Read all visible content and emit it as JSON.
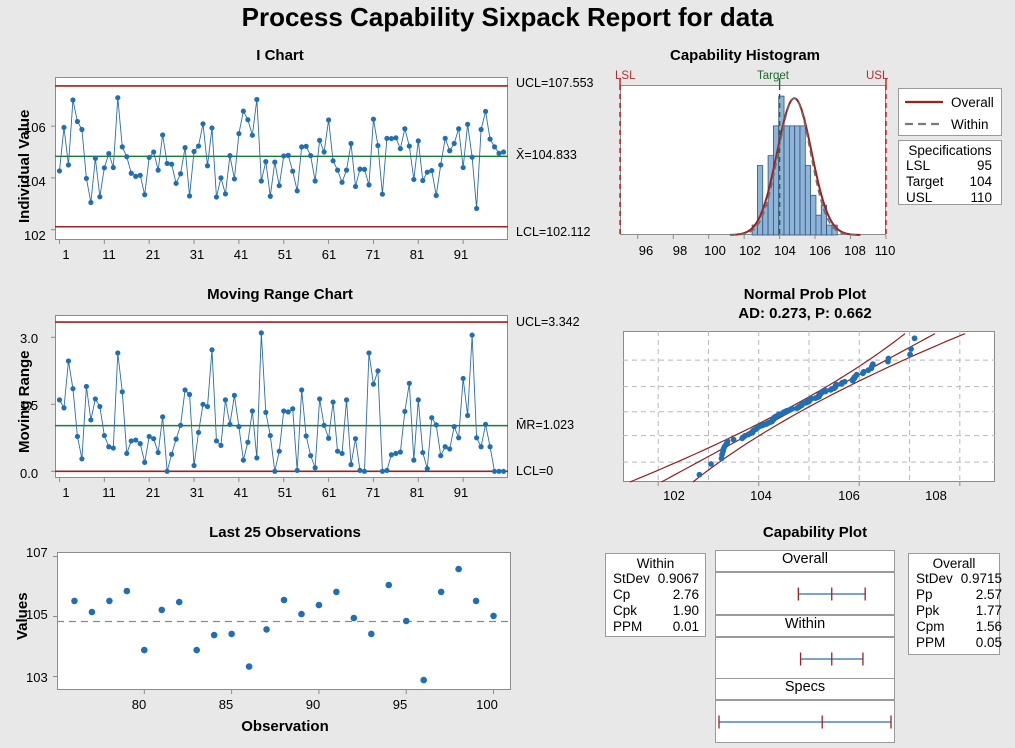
{
  "report": {
    "title": "Process Capability Sixpack Report for data"
  },
  "ichart": {
    "title": "I Chart",
    "ylabel": "Individual Value",
    "yticks": [
      "106",
      "104",
      "102"
    ],
    "xticks": [
      "1",
      "11",
      "21",
      "31",
      "41",
      "51",
      "61",
      "71",
      "81",
      "91"
    ],
    "ucl_label": "UCL=107.553",
    "center_label": "X̄=104.833",
    "lcl_label": "LCL=102.112"
  },
  "mrchart": {
    "title": "Moving Range Chart",
    "ylabel": "Moving Range",
    "yticks": [
      "3.0",
      "1.5",
      "0.0"
    ],
    "xticks": [
      "1",
      "11",
      "21",
      "31",
      "41",
      "51",
      "61",
      "71",
      "81",
      "91"
    ],
    "ucl_label": "UCL=3.342",
    "center_label": "M̄R=1.023",
    "lcl_label": "LCL=0"
  },
  "last25": {
    "title": "Last 25 Observations",
    "ylabel": "Values",
    "xlabel": "Observation",
    "yticks": [
      "107",
      "105",
      "103"
    ],
    "xticks": [
      "80",
      "85",
      "90",
      "95",
      "100"
    ]
  },
  "histogram": {
    "title": "Capability Histogram",
    "lsl_marker": "LSL",
    "target_marker": "Target",
    "usl_marker": "USL",
    "xticks": [
      "96",
      "98",
      "100",
      "102",
      "104",
      "106",
      "108",
      "110"
    ],
    "legend": [
      {
        "label": "Overall",
        "style": "solid",
        "color": "#9e2121"
      },
      {
        "label": "Within",
        "style": "dashed",
        "color": "#7a7a7a"
      }
    ],
    "spec_box": {
      "header": "Specifications",
      "rows": [
        {
          "key": "LSL",
          "value": "95"
        },
        {
          "key": "Target",
          "value": "104"
        },
        {
          "key": "USL",
          "value": "110"
        }
      ]
    }
  },
  "probplot": {
    "title": "Normal Prob Plot",
    "subtitle": "AD: 0.273, P: 0.662",
    "xticks": [
      "102",
      "104",
      "106",
      "108"
    ]
  },
  "capplot": {
    "title": "Capability Plot",
    "within_box": {
      "header": "Within",
      "rows": [
        {
          "key": "StDev",
          "value": "0.9067"
        },
        {
          "key": "Cp",
          "value": "2.76"
        },
        {
          "key": "Cpk",
          "value": "1.90"
        },
        {
          "key": "PPM",
          "value": "0.01"
        }
      ]
    },
    "overall_box": {
      "header": "Overall",
      "rows": [
        {
          "key": "StDev",
          "value": "0.9715"
        },
        {
          "key": "Pp",
          "value": "2.57"
        },
        {
          "key": "Ppk",
          "value": "1.77"
        },
        {
          "key": "Cpm",
          "value": "1.56"
        },
        {
          "key": "PPM",
          "value": "0.05"
        }
      ]
    },
    "bands": [
      {
        "label": "Overall"
      },
      {
        "label": "Within"
      },
      {
        "label": "Specs"
      }
    ]
  },
  "colors": {
    "background": "#e8e8e8",
    "plot_bg": "#ffffff",
    "control_limit": "#9e2121",
    "center_line": "#1a7a36",
    "marker": "#1f6fb4",
    "connect_line": "#2c6ea5",
    "bar_fill": "#8fb4d9",
    "bar_edge": "#33557a",
    "overall_curve": "#9e2121",
    "within_curve": "#6e6e6e",
    "target_line": "#1a6b2a",
    "spec_line": "#c01b1b",
    "grid": "#b8b8b8",
    "frame": "#8c8c8c"
  },
  "chart_data": {
    "type": "line",
    "title": "Process Capability Sixpack Report for data",
    "charts": [
      {
        "name": "I Chart",
        "type": "line",
        "ylabel": "Individual Value",
        "xlabel": "",
        "ylim": [
          101.6,
          107.9
        ],
        "xlim": [
          0,
          101
        ],
        "ucl": 107.553,
        "center": 104.833,
        "lcl": 102.112,
        "x": [
          1,
          2,
          3,
          4,
          5,
          6,
          7,
          8,
          9,
          10,
          11,
          12,
          13,
          14,
          15,
          16,
          17,
          18,
          19,
          20,
          21,
          22,
          23,
          24,
          25,
          26,
          27,
          28,
          29,
          30,
          31,
          32,
          33,
          34,
          35,
          36,
          37,
          38,
          39,
          40,
          41,
          42,
          43,
          44,
          45,
          46,
          47,
          48,
          49,
          50,
          51,
          52,
          53,
          54,
          55,
          56,
          57,
          58,
          59,
          60,
          61,
          62,
          63,
          64,
          65,
          66,
          67,
          68,
          69,
          70,
          71,
          72,
          73,
          74,
          75,
          76,
          77,
          78,
          79,
          80,
          81,
          82,
          83,
          84,
          85,
          86,
          87,
          88,
          89,
          90,
          91,
          92,
          93,
          94,
          95,
          96,
          97,
          98,
          99,
          100
        ],
        "values": [
          104.27,
          105.95,
          104.5,
          107.01,
          106.18,
          105.87,
          103.98,
          103.05,
          104.76,
          103.27,
          104.39,
          104.94,
          104.4,
          107.1,
          105.2,
          104.82,
          104.18,
          104.06,
          104.1,
          103.35,
          104.79,
          105.0,
          104.3,
          105.66,
          104.56,
          104.53,
          103.79,
          104.16,
          105.17,
          103.3,
          105.02,
          105.23,
          106.09,
          104.47,
          105.93,
          103.26,
          104.0,
          103.38,
          104.86,
          103.96,
          105.71,
          106.58,
          106.25,
          105.65,
          107.03,
          103.88,
          104.63,
          103.29,
          104.61,
          103.7,
          104.85,
          104.87,
          104.26,
          103.5,
          105.2,
          105.22,
          104.86,
          103.88,
          105.45,
          105.0,
          106.24,
          104.66,
          104.3,
          103.83,
          104.3,
          105.33,
          103.67,
          104.34,
          104.33,
          103.73,
          106.27,
          105.25,
          103.37,
          105.53,
          105.52,
          105.55,
          105.13,
          105.9,
          105.23,
          103.94,
          105.43,
          103.9,
          104.22,
          104.28,
          103.32,
          104.5,
          105.53,
          105.05,
          105.33,
          105.9,
          104.4,
          106.07,
          104.8,
          102.82,
          105.87,
          106.57,
          105.5,
          105.2,
          104.95,
          105.0
        ]
      },
      {
        "name": "Moving Range Chart",
        "type": "line",
        "ylabel": "Moving Range",
        "xlabel": "",
        "ylim": [
          -0.15,
          3.5
        ],
        "xlim": [
          0,
          101
        ],
        "ucl": 3.342,
        "center": 1.023,
        "lcl": 0,
        "x": [
          1,
          2,
          3,
          4,
          5,
          6,
          7,
          8,
          9,
          10,
          11,
          12,
          13,
          14,
          15,
          16,
          17,
          18,
          19,
          20,
          21,
          22,
          23,
          24,
          25,
          26,
          27,
          28,
          29,
          30,
          31,
          32,
          33,
          34,
          35,
          36,
          37,
          38,
          39,
          40,
          41,
          42,
          43,
          44,
          45,
          46,
          47,
          48,
          49,
          50,
          51,
          52,
          53,
          54,
          55,
          56,
          57,
          58,
          59,
          60,
          61,
          62,
          63,
          64,
          65,
          66,
          67,
          68,
          69,
          70,
          71,
          72,
          73,
          74,
          75,
          76,
          77,
          78,
          79,
          80,
          81,
          82,
          83,
          84,
          85,
          86,
          87,
          88,
          89,
          90,
          91,
          92,
          93,
          94,
          95,
          96,
          97,
          98,
          99,
          100
        ],
        "values": [
          1.6,
          1.42,
          2.47,
          1.85,
          0.78,
          0.28,
          1.9,
          1.15,
          1.62,
          1.45,
          0.8,
          0.55,
          0.52,
          2.65,
          1.78,
          0.4,
          0.68,
          0.7,
          0.62,
          0.2,
          0.78,
          0.73,
          0.42,
          1.22,
          0.0,
          0.38,
          0.72,
          1.03,
          1.82,
          1.72,
          0.13,
          0.87,
          1.5,
          1.45,
          2.72,
          0.68,
          0.58,
          1.6,
          1.05,
          1.7,
          1.0,
          0.25,
          0.65,
          1.35,
          0.3,
          3.1,
          1.32,
          0.8,
          0.0,
          0.45,
          1.35,
          1.33,
          1.4,
          0.02,
          1.82,
          0.79,
          0.35,
          0.08,
          1.62,
          1.03,
          0.74,
          1.55,
          0.45,
          0.4,
          1.6,
          0.15,
          0.73,
          0.02,
          0.0,
          2.65,
          1.95,
          2.25,
          0.0,
          0.02,
          0.37,
          0.4,
          0.43,
          1.34,
          1.97,
          0.25,
          1.6,
          0.42,
          0.06,
          1.2,
          1.04,
          0.35,
          0.55,
          0.5,
          1.0,
          0.75,
          2.08,
          1.25,
          3.05,
          0.75,
          0.55,
          1.05,
          0.55,
          0.0,
          0.0,
          0.0,
          0.0
        ]
      },
      {
        "name": "Last 25 Observations",
        "type": "scatter",
        "ylabel": "Values",
        "xlabel": "Observation",
        "ylim": [
          102.55,
          107.15
        ],
        "xlim": [
          75,
          101
        ],
        "center": 104.833,
        "x": [
          76,
          77,
          78,
          79,
          80,
          81,
          82,
          83,
          84,
          85,
          86,
          87,
          88,
          89,
          90,
          91,
          92,
          93,
          94,
          95,
          96,
          97,
          98,
          99,
          100
        ],
        "values": [
          105.52,
          105.15,
          105.52,
          105.85,
          103.88,
          105.22,
          105.48,
          103.88,
          104.38,
          104.42,
          103.33,
          104.57,
          105.55,
          105.08,
          105.38,
          105.82,
          104.95,
          104.42,
          106.05,
          104.85,
          102.88,
          105.82,
          106.58,
          105.52,
          105.02
        ]
      },
      {
        "name": "Capability Histogram",
        "type": "bar",
        "xlabel": "",
        "ylabel": "",
        "xlim": [
          95,
          110
        ],
        "lsl": 95,
        "target": 104,
        "usl": 110,
        "bin_centers": [
          102.6,
          102.9,
          103.2,
          103.5,
          103.8,
          104.1,
          104.4,
          104.7,
          105.0,
          105.3,
          105.6,
          105.9,
          106.2,
          106.5,
          106.8,
          107.1
        ],
        "bin_counts": [
          1,
          7,
          3,
          8,
          11,
          14,
          11,
          11,
          11,
          11,
          7,
          4,
          2,
          3,
          1,
          1
        ]
      },
      {
        "name": "Normal Prob Plot",
        "type": "scatter",
        "subtitle": "AD: 0.273, P: 0.662",
        "ad": 0.273,
        "p": 0.662,
        "xlim": [
          101.3,
          108.7
        ],
        "xticks": [
          102,
          104,
          106,
          108
        ]
      },
      {
        "name": "Capability Plot",
        "type": "table",
        "within": {
          "StDev": 0.9067,
          "Cp": 2.76,
          "Cpk": 1.9,
          "PPM": 0.01
        },
        "overall": {
          "StDev": 0.9715,
          "Pp": 2.57,
          "Ppk": 1.77,
          "Cpm": 1.56,
          "PPM": 0.05
        },
        "bands": [
          "Overall",
          "Within",
          "Specs"
        ]
      }
    ]
  }
}
